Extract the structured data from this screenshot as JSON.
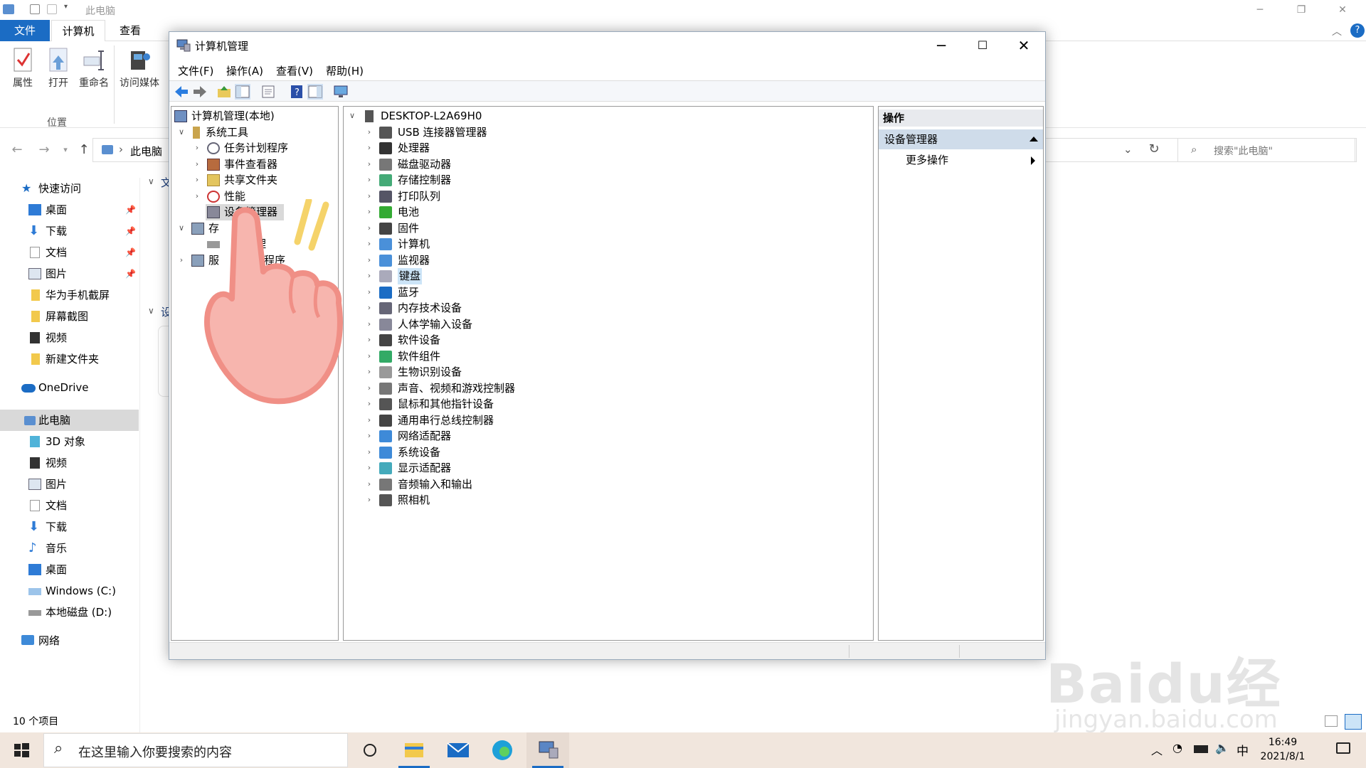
{
  "explorer": {
    "title": "此电脑",
    "tabs": {
      "file": "文件",
      "computer": "计算机",
      "view": "查看"
    },
    "ribbon": {
      "properties": "属性",
      "open": "打开",
      "rename": "重命名",
      "access_media": "访问媒体",
      "group_label": "位置"
    },
    "address": {
      "path": "此电脑",
      "search_placeholder": "搜索\"此电脑\""
    },
    "nav": {
      "quick_access": "快速访问",
      "quick_items": [
        {
          "label": "桌面"
        },
        {
          "label": "下载"
        },
        {
          "label": "文档"
        },
        {
          "label": "图片"
        },
        {
          "label": "华为手机截屏"
        },
        {
          "label": "屏幕截图"
        },
        {
          "label": "视频"
        },
        {
          "label": "新建文件夹"
        }
      ],
      "onedrive": "OneDrive",
      "this_pc": "此电脑",
      "pc_items": [
        {
          "label": "3D 对象"
        },
        {
          "label": "视频"
        },
        {
          "label": "图片"
        },
        {
          "label": "文档"
        },
        {
          "label": "下载"
        },
        {
          "label": "音乐"
        },
        {
          "label": "桌面"
        },
        {
          "label": "Windows  (C:)"
        },
        {
          "label": "本地磁盘 (D:)"
        }
      ],
      "network": "网络"
    },
    "content_fragments": {
      "folders_prefix": "文",
      "devices_prefix": "设"
    },
    "status": "10 个项目"
  },
  "mmc": {
    "title": "计算机管理",
    "menu": {
      "file": "文件(F)",
      "action": "操作(A)",
      "view": "查看(V)",
      "help": "帮助(H)"
    },
    "left_tree": {
      "root": "计算机管理(本地)",
      "system_tools": "系统工具",
      "system_children": [
        "任务计划程序",
        "事件查看器",
        "共享文件夹",
        "性能",
        "设备管理器"
      ],
      "storage": "存储",
      "disk_mgmt": "磁盘管理",
      "services": "服务和应用程序",
      "visible_fragments": {
        "storage": "存",
        "disk_mgmt": "理",
        "services_a": "服",
        "services_b": "程序"
      }
    },
    "device_tree": {
      "root": "DESKTOP-L2A69H0",
      "items": [
        "USB 连接器管理器",
        "处理器",
        "磁盘驱动器",
        "存储控制器",
        "打印队列",
        "电池",
        "固件",
        "计算机",
        "监视器",
        "键盘",
        "蓝牙",
        "内存技术设备",
        "人体学输入设备",
        "软件设备",
        "软件组件",
        "生物识别设备",
        "声音、视频和游戏控制器",
        "鼠标和其他指针设备",
        "通用串行总线控制器",
        "网络适配器",
        "系统设备",
        "显示适配器",
        "音频输入和输出",
        "照相机"
      ],
      "selected_index": 9
    },
    "actions": {
      "header": "操作",
      "section": "设备管理器",
      "more": "更多操作"
    }
  },
  "taskbar": {
    "search_placeholder": "在这里输入你要搜索的内容",
    "ime": "中",
    "time": "16:49",
    "date": "2021/8/1"
  },
  "watermark": {
    "brand": "Baidu经验",
    "url": "jingyan.baidu.com"
  },
  "colors": {
    "accent": "#1b6cc4",
    "taskbar": "#f1e6dd",
    "selection": "#cce4f7",
    "hand": "#f7a6a0"
  }
}
